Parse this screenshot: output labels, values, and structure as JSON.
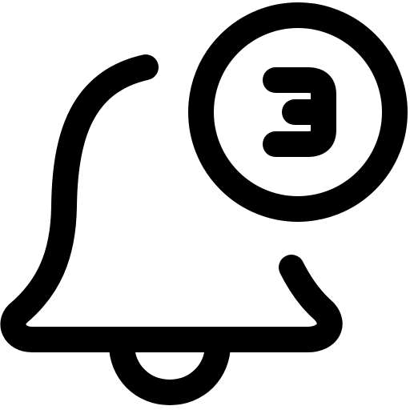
{
  "icon": {
    "name": "notification-bell-3-icon",
    "stroke_color": "#000000",
    "background_color": "#ffffff"
  }
}
